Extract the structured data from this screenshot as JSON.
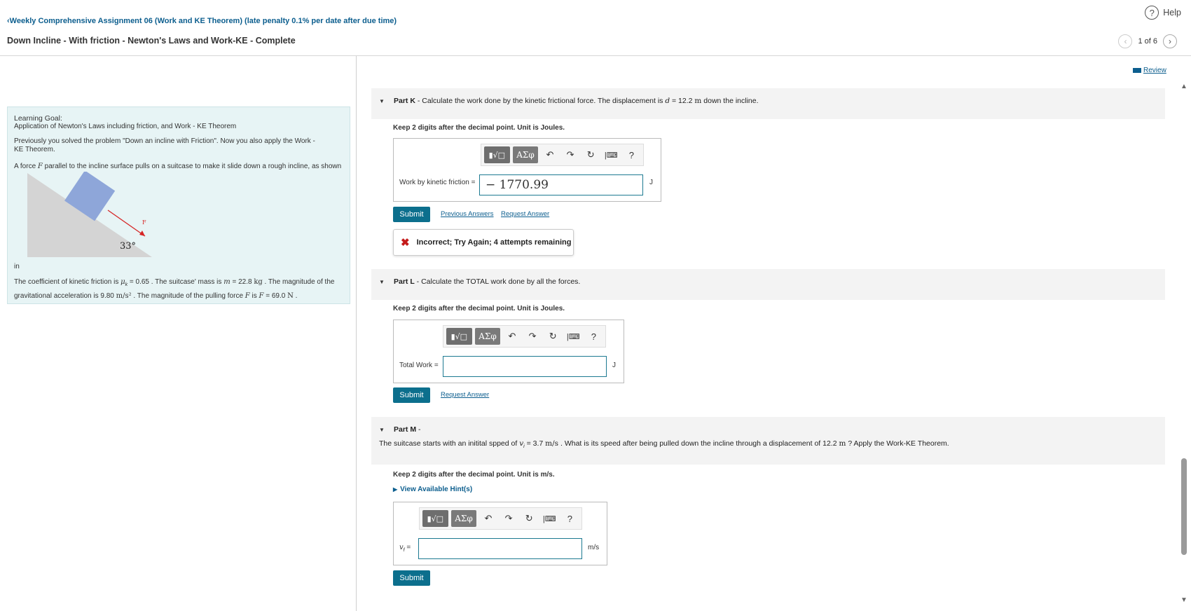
{
  "header": {
    "assignment_link": "Weekly Comprehensive Assignment 06 (Work and KE Theorem) (late penalty 0.1% per date after due time)",
    "problem_title": "Down Incline - With friction  - Newton's Laws and Work-KE - Complete",
    "help_label": "Help",
    "pager_text": "1 of 6"
  },
  "review_label": "Review",
  "learning_goal": {
    "heading": "Learning Goal:",
    "goal_text": "Application of Newton's Laws including friction, and Work - KE Theorem",
    "previous": "Previously you solved the problem \"Down an incline with Friction\". Now you also apply the Work - KE Theorem.",
    "force_prefix": "A force ",
    "force_symbol": "F",
    "force_suffix": " parallel to the incline surface pulls on a suitcase to make it slide down a rough incline, as shown",
    "diagram_angle": "33°",
    "diagram_force_label": "F",
    "in_text": "in",
    "coef_a": "The coefficient of kinetic friction is ",
    "mu_sym": "μ",
    "mu_sub": "k",
    "coef_b": " = 0.65 . The suitcase' mass is ",
    "m_sym": "m",
    "coef_c": " = 22.8 ",
    "kg": "kg",
    "coef_d": " . The magnitude of the gravitational acceleration is 9.80 ",
    "accel_unit": "m/s²",
    "coef_e": " . The magnitude of the pulling force ",
    "F_sym": "F",
    "coef_f": " is ",
    "F_val_sym": "F",
    "coef_g": " = 69.0 ",
    "N": "N",
    "coef_h": " ."
  },
  "part_k": {
    "title": "Part K",
    "text_a": " - Calculate the work done by the kinetic frictional force. The displacement is ",
    "d_sym": "d",
    "text_b": " = 12.2 ",
    "m_unit": "m",
    "text_c": " down the incline.",
    "keep": "Keep 2 digits after the decimal point. Unit is Joules.",
    "label": "Work by kinetic friction =",
    "value": "− 1770.99",
    "unit": "J",
    "submit": "Submit",
    "prev_answers": "Previous Answers",
    "request_answer": "Request Answer",
    "feedback": "Incorrect; Try Again; 4 attempts remaining"
  },
  "part_l": {
    "title": "Part L",
    "text": " - Calculate the  TOTAL work done by all the forces.",
    "keep": "Keep 2 digits after the decimal point. Unit is Joules.",
    "label": "Total Work =",
    "value": "",
    "unit": "J",
    "submit": "Submit",
    "request_answer": "Request Answer"
  },
  "part_m": {
    "title": "Part M",
    "title_suffix": " -",
    "desc_a": "The suitcase starts with an initital spped of ",
    "v_sym": "v",
    "v_sub": "i",
    "desc_b": " = 3.7 ",
    "speed_unit": "m/s",
    "desc_c": " . What is its speed after being pulled down the incline through a displacement of 12.2 ",
    "m_unit": "m",
    "desc_d": " ? Apply the Work-KE Theorem.",
    "keep": "Keep 2 digits after the decimal point. Unit is m/s.",
    "hint": "View Available Hint(s)",
    "label_sym": "v",
    "label_sub": "f",
    "label_eq": " =",
    "value": "",
    "unit": "m/s",
    "submit": "Submit"
  },
  "toolbar": {
    "template_glyph": "▮√□",
    "greek_glyph": "ΑΣφ",
    "undo": "↶",
    "redo": "↷",
    "reset": "↻",
    "keyboard": "|⌨",
    "help": "?"
  },
  "icons": {
    "back_chevron": "‹",
    "prev_chevron": "‹",
    "next_chevron": "›",
    "help_glyph": "?",
    "part_toggle": "▼",
    "hint_toggle": "▶",
    "feedback_x": "✖",
    "scroll_up": "▲",
    "scroll_down": "▼"
  },
  "colors": {
    "accent": "#0c6f8d",
    "link": "#0c5e8e",
    "goal_bg": "#e7f4f5",
    "error": "#c41a1a",
    "suitcase": "#8ea6d9",
    "arrow": "#d62424"
  }
}
